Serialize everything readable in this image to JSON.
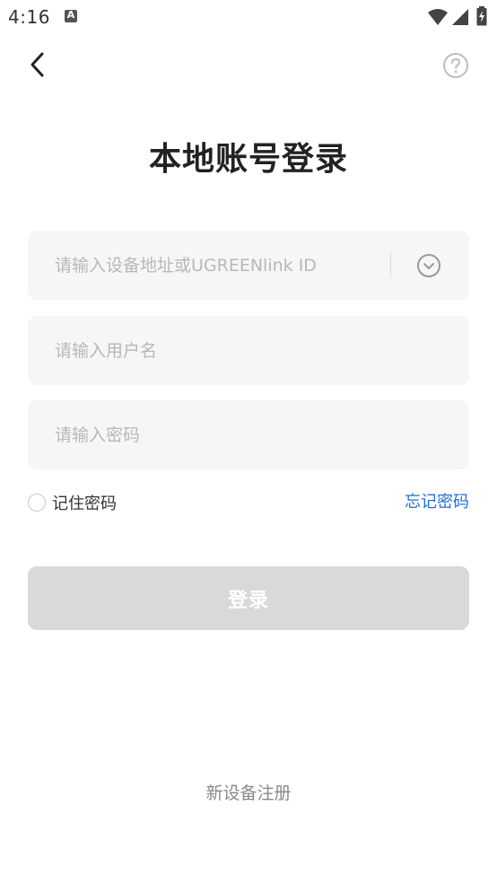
{
  "status_bar": {
    "time": "4:16",
    "notification_icon": "a-notification-icon",
    "wifi_icon": "wifi-icon",
    "signal_icon": "signal-icon",
    "battery_icon": "battery-charging-icon"
  },
  "nav": {
    "back_icon": "chevron-left-icon",
    "help_icon": "question-circle-icon"
  },
  "title": "本地账号登录",
  "form": {
    "address_placeholder": "请输入设备地址或UGREENlink ID",
    "address_value": "",
    "dropdown_icon": "chevron-down-circle-icon",
    "username_placeholder": "请输入用户名",
    "username_value": "",
    "password_placeholder": "请输入密码",
    "password_value": "",
    "remember_label": "记住密码",
    "remember_checked": false,
    "forgot_label": "忘记密码",
    "login_label": "登录"
  },
  "register_label": "新设备注册",
  "colors": {
    "accent_link": "#1f6fd6",
    "button_disabled": "#d9d9d9",
    "input_bg": "#f6f6f6",
    "placeholder": "#b8b8b8"
  }
}
